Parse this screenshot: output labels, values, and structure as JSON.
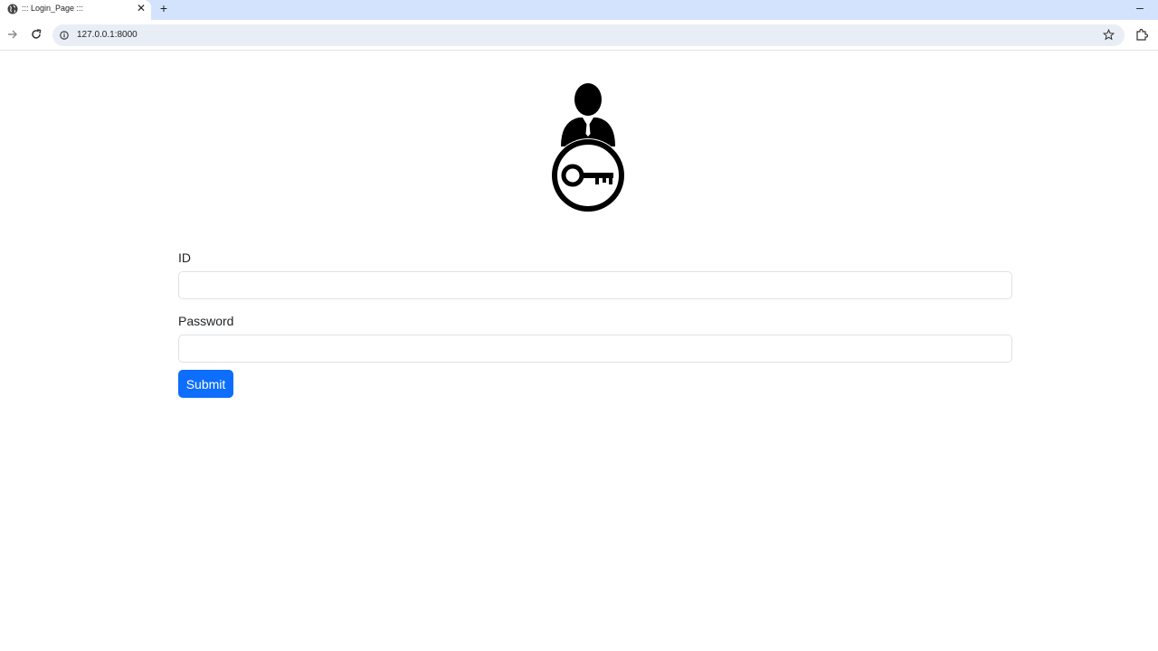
{
  "browser": {
    "tab_title": "::: Login_Page :::",
    "tab_close": "✕",
    "new_tab": "+",
    "minimize": "–",
    "url": "127.0.0.1:8000"
  },
  "form": {
    "id_label": "ID",
    "id_value": "",
    "password_label": "Password",
    "password_value": "",
    "submit_label": "Submit"
  },
  "colors": {
    "submit_bg": "#0d6efd",
    "tabstrip_bg": "#d3e3fd",
    "omnibox_bg": "#e9eef6"
  },
  "icons": {
    "tab_favicon": "globe-icon",
    "back": "back-arrow-icon",
    "reload": "reload-icon",
    "site_info": "info-icon",
    "bookmark": "star-icon",
    "extensions": "puzzle-icon",
    "logo": "user-key-icon"
  }
}
